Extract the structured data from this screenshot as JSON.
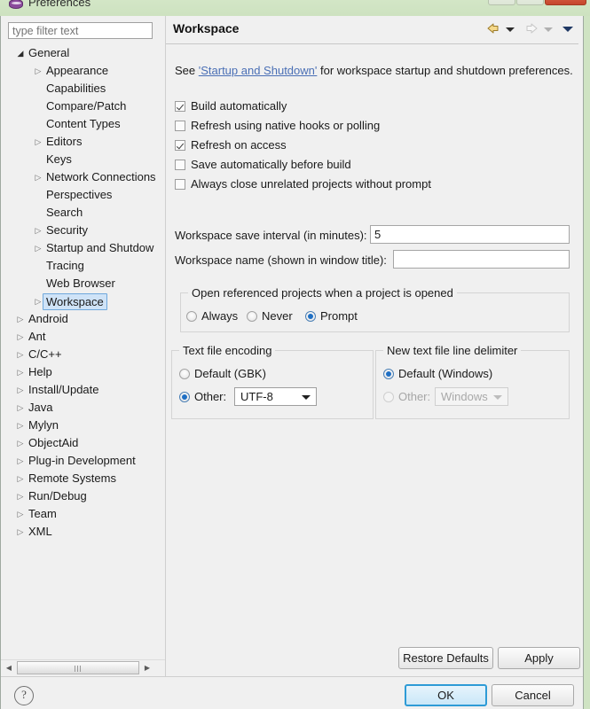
{
  "window": {
    "title": "Preferences",
    "icon": "preferences-window-icon",
    "minimize_glyph": "—",
    "maximize_glyph": "▭",
    "close_glyph": "✕"
  },
  "filter": {
    "placeholder": "type filter text",
    "value": ""
  },
  "tree": {
    "items": [
      {
        "label": "General",
        "level": 0,
        "arrow": "collapse",
        "selected": false
      },
      {
        "label": "Appearance",
        "level": 1,
        "arrow": "expand",
        "selected": false
      },
      {
        "label": "Capabilities",
        "level": 1,
        "arrow": "none",
        "selected": false
      },
      {
        "label": "Compare/Patch",
        "level": 1,
        "arrow": "none",
        "selected": false
      },
      {
        "label": "Content Types",
        "level": 1,
        "arrow": "none",
        "selected": false
      },
      {
        "label": "Editors",
        "level": 1,
        "arrow": "expand",
        "selected": false
      },
      {
        "label": "Keys",
        "level": 1,
        "arrow": "none",
        "selected": false
      },
      {
        "label": "Network Connections",
        "level": 1,
        "arrow": "expand",
        "selected": false
      },
      {
        "label": "Perspectives",
        "level": 1,
        "arrow": "none",
        "selected": false
      },
      {
        "label": "Search",
        "level": 1,
        "arrow": "none",
        "selected": false
      },
      {
        "label": "Security",
        "level": 1,
        "arrow": "expand",
        "selected": false
      },
      {
        "label": "Startup and Shutdow",
        "level": 1,
        "arrow": "expand",
        "selected": false
      },
      {
        "label": "Tracing",
        "level": 1,
        "arrow": "none",
        "selected": false
      },
      {
        "label": "Web Browser",
        "level": 1,
        "arrow": "none",
        "selected": false
      },
      {
        "label": "Workspace",
        "level": 1,
        "arrow": "expand",
        "selected": true
      },
      {
        "label": "Android",
        "level": 0,
        "arrow": "expand",
        "selected": false
      },
      {
        "label": "Ant",
        "level": 0,
        "arrow": "expand",
        "selected": false
      },
      {
        "label": "C/C++",
        "level": 0,
        "arrow": "expand",
        "selected": false
      },
      {
        "label": "Help",
        "level": 0,
        "arrow": "expand",
        "selected": false
      },
      {
        "label": "Install/Update",
        "level": 0,
        "arrow": "expand",
        "selected": false
      },
      {
        "label": "Java",
        "level": 0,
        "arrow": "expand",
        "selected": false
      },
      {
        "label": "Mylyn",
        "level": 0,
        "arrow": "expand",
        "selected": false
      },
      {
        "label": "ObjectAid",
        "level": 0,
        "arrow": "expand",
        "selected": false
      },
      {
        "label": "Plug-in Development",
        "level": 0,
        "arrow": "expand",
        "selected": false
      },
      {
        "label": "Remote Systems",
        "level": 0,
        "arrow": "expand",
        "selected": false
      },
      {
        "label": "Run/Debug",
        "level": 0,
        "arrow": "expand",
        "selected": false
      },
      {
        "label": "Team",
        "level": 0,
        "arrow": "expand",
        "selected": false
      },
      {
        "label": "XML",
        "level": 0,
        "arrow": "expand",
        "selected": false
      }
    ]
  },
  "page": {
    "title": "Workspace",
    "intro_prefix": "See ",
    "intro_link": "'Startup and Shutdown'",
    "intro_suffix": " for workspace startup and shutdown preferences.",
    "checkboxes": [
      {
        "label": "Build automatically",
        "checked": true
      },
      {
        "label": "Refresh using native hooks or polling",
        "checked": false
      },
      {
        "label": "Refresh on access",
        "checked": true
      },
      {
        "label": "Save automatically before build",
        "checked": false
      },
      {
        "label": "Always close unrelated projects without prompt",
        "checked": false
      }
    ],
    "save_interval": {
      "label": "Workspace save interval (in minutes):",
      "value": "5"
    },
    "workspace_name": {
      "label": "Workspace name (shown in window title):",
      "value": ""
    },
    "open_referenced": {
      "title": "Open referenced projects when a project is opened",
      "options": [
        {
          "label": "Always",
          "selected": false
        },
        {
          "label": "Never",
          "selected": false
        },
        {
          "label": "Prompt",
          "selected": true
        }
      ]
    },
    "text_file_encoding": {
      "title": "Text file encoding",
      "default_label": "Default (GBK)",
      "default_selected": false,
      "other_label": "Other:",
      "other_selected": true,
      "other_value": "UTF-8"
    },
    "line_delimiter": {
      "title": "New text file line delimiter",
      "default_label": "Default (Windows)",
      "default_selected": true,
      "other_label": "Other:",
      "other_selected": false,
      "other_value": "Windows"
    },
    "restore_defaults_label": "Restore Defaults",
    "apply_label": "Apply"
  },
  "footer": {
    "help_glyph": "?",
    "ok_label": "OK",
    "cancel_label": "Cancel"
  }
}
